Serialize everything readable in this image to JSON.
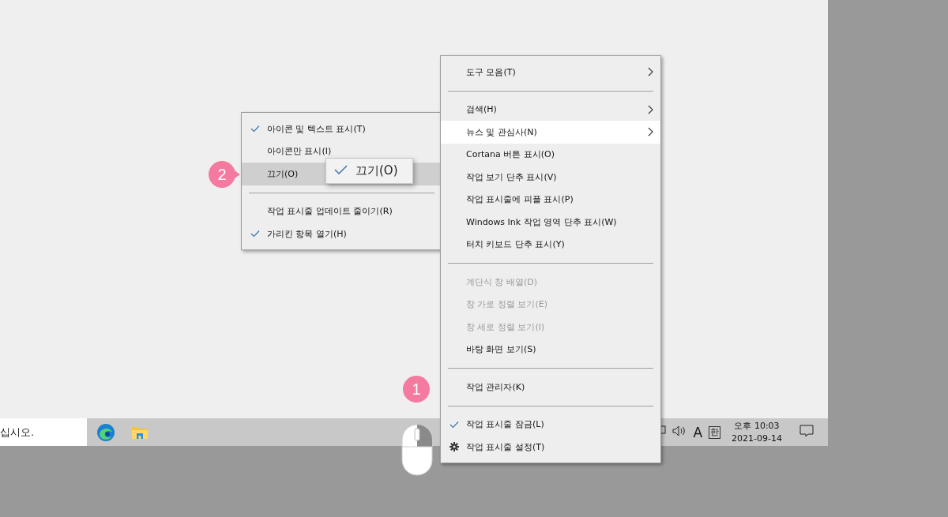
{
  "menu": {
    "items": [
      {
        "kind": "item",
        "label": "도구 모음(T)",
        "submenu": true,
        "selected": false,
        "checked": false,
        "disabled": false
      },
      {
        "kind": "separator"
      },
      {
        "kind": "item",
        "label": "검색(H)",
        "submenu": true,
        "selected": false,
        "checked": false,
        "disabled": false
      },
      {
        "kind": "item",
        "label": "뉴스 및 관심사(N)",
        "submenu": true,
        "selected": true,
        "checked": false,
        "disabled": false
      },
      {
        "kind": "item",
        "label": "Cortana 버튼 표시(O)",
        "submenu": false,
        "selected": false,
        "checked": false,
        "disabled": false
      },
      {
        "kind": "item",
        "label": "작업 보기 단추 표시(V)",
        "submenu": false,
        "selected": false,
        "checked": false,
        "disabled": false
      },
      {
        "kind": "item",
        "label": "작업 표시줄에 피플 표시(P)",
        "submenu": false,
        "selected": false,
        "checked": false,
        "disabled": false
      },
      {
        "kind": "item",
        "label": "Windows Ink 작업 영역 단추 표시(W)",
        "submenu": false,
        "selected": false,
        "checked": false,
        "disabled": false
      },
      {
        "kind": "item",
        "label": "터치 키보드 단추 표시(Y)",
        "submenu": false,
        "selected": false,
        "checked": false,
        "disabled": false
      },
      {
        "kind": "separator"
      },
      {
        "kind": "item",
        "label": "계단식 창 배열(D)",
        "submenu": false,
        "selected": false,
        "checked": false,
        "disabled": true
      },
      {
        "kind": "item",
        "label": "창 가로 정렬 보기(E)",
        "submenu": false,
        "selected": false,
        "checked": false,
        "disabled": true
      },
      {
        "kind": "item",
        "label": "창 세로 정렬 보기(I)",
        "submenu": false,
        "selected": false,
        "checked": false,
        "disabled": true
      },
      {
        "kind": "item",
        "label": "바탕 화면 보기(S)",
        "submenu": false,
        "selected": false,
        "checked": false,
        "disabled": false
      },
      {
        "kind": "separator"
      },
      {
        "kind": "item",
        "label": "작업 관리자(K)",
        "submenu": false,
        "selected": false,
        "checked": false,
        "disabled": false
      },
      {
        "kind": "separator"
      },
      {
        "kind": "item",
        "label": "작업 표시줄 잠금(L)",
        "submenu": false,
        "selected": false,
        "checked": true,
        "disabled": false
      },
      {
        "kind": "settings",
        "label": "작업 표시줄 설정(T)",
        "submenu": false,
        "selected": false,
        "checked": false,
        "disabled": false
      }
    ]
  },
  "submenu": {
    "items": [
      {
        "kind": "item",
        "label": "아이콘 및 텍스트 표시(T)",
        "submenu": false,
        "selected": false,
        "checked": true,
        "disabled": false
      },
      {
        "kind": "item",
        "label": "아이콘만 표시(I)",
        "submenu": false,
        "selected": false,
        "checked": false,
        "disabled": false
      },
      {
        "kind": "item",
        "label": "끄기(O)",
        "submenu": false,
        "selected": true,
        "checked": false,
        "disabled": false
      },
      {
        "kind": "separator"
      },
      {
        "kind": "item",
        "label": "작업 표시줄 업데이트 줄이기(R)",
        "submenu": false,
        "selected": false,
        "checked": false,
        "disabled": false
      },
      {
        "kind": "item",
        "label": "가리킨 항목 열기(H)",
        "submenu": false,
        "selected": false,
        "checked": true,
        "disabled": false
      }
    ]
  },
  "popup": {
    "label": "끄기(O)",
    "checked": true
  },
  "badges": [
    {
      "label": "1"
    },
    {
      "label": "2"
    }
  ],
  "taskbar": {
    "search_text": "십시오.",
    "input_indicator": "A",
    "ime": "한",
    "time": "오후 10:03",
    "date": "2021-09-14"
  }
}
